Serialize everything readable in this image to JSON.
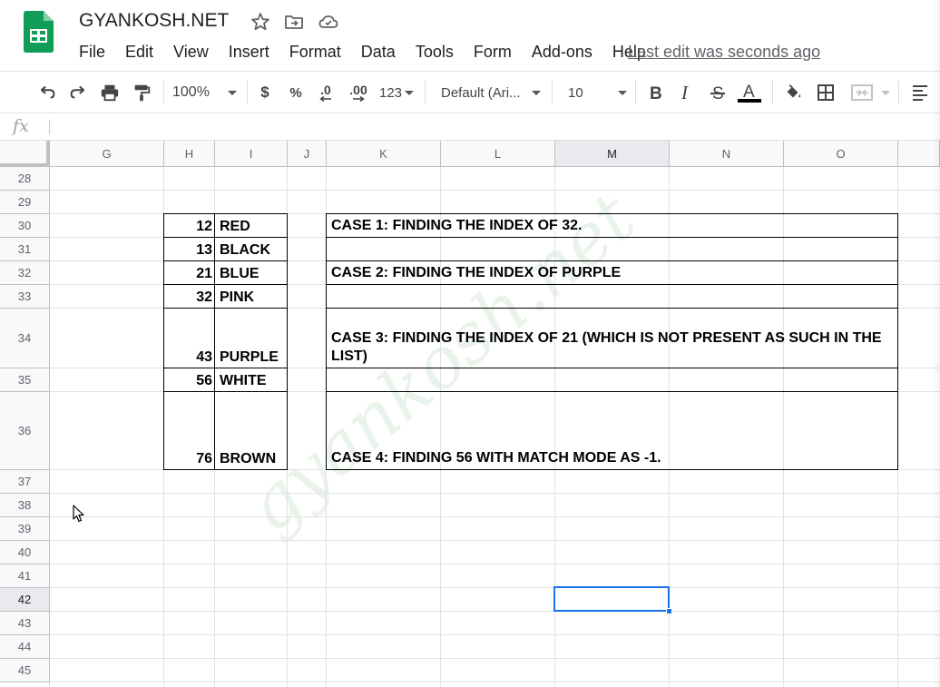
{
  "document": {
    "title": "GYANKOSH.NET",
    "last_edit": "Last edit was seconds ago"
  },
  "menu": [
    "File",
    "Edit",
    "View",
    "Insert",
    "Format",
    "Data",
    "Tools",
    "Form",
    "Add-ons",
    "Help"
  ],
  "toolbar": {
    "zoom": "100%",
    "currency": "$",
    "percent": "%",
    "dec_decrease": ".0",
    "dec_increase": ".00",
    "more_formats": "123",
    "font": "Default (Ari...",
    "font_size": "10",
    "text_color": "#000000"
  },
  "formula_bar": {
    "fx_label": "fx",
    "value": ""
  },
  "grid": {
    "columns": [
      "G",
      "H",
      "I",
      "J",
      "K",
      "L",
      "M",
      "N",
      "O"
    ],
    "selected_column": "M",
    "rows": [
      "28",
      "29",
      "30",
      "31",
      "32",
      "33",
      "34",
      "35",
      "36",
      "37",
      "38",
      "39",
      "40",
      "41",
      "42",
      "43",
      "44",
      "45"
    ],
    "selected_row": "42",
    "active_cell": "M42",
    "table": [
      {
        "num": "12",
        "color": "RED",
        "case": "CASE 1: FINDING THE INDEX OF 32."
      },
      {
        "num": "13",
        "color": "BLACK",
        "case": ""
      },
      {
        "num": "21",
        "color": "BLUE",
        "case": "CASE 2: FINDING THE INDEX OF PURPLE"
      },
      {
        "num": "32",
        "color": "PINK",
        "case": ""
      },
      {
        "num": "43",
        "color": "PURPLE",
        "case": "CASE 3: FINDING THE INDEX OF 21 (WHICH IS NOT PRESENT AS SUCH IN THE LIST)"
      },
      {
        "num": "56",
        "color": "WHITE",
        "case": ""
      },
      {
        "num": "76",
        "color": "BROWN",
        "case": "CASE 4: FINDING 56 WITH MATCH MODE AS -1."
      }
    ]
  },
  "watermark": "gyankosh.net",
  "colors": {
    "brand_green": "#0f9d58",
    "selection_blue": "#1a73e8"
  }
}
